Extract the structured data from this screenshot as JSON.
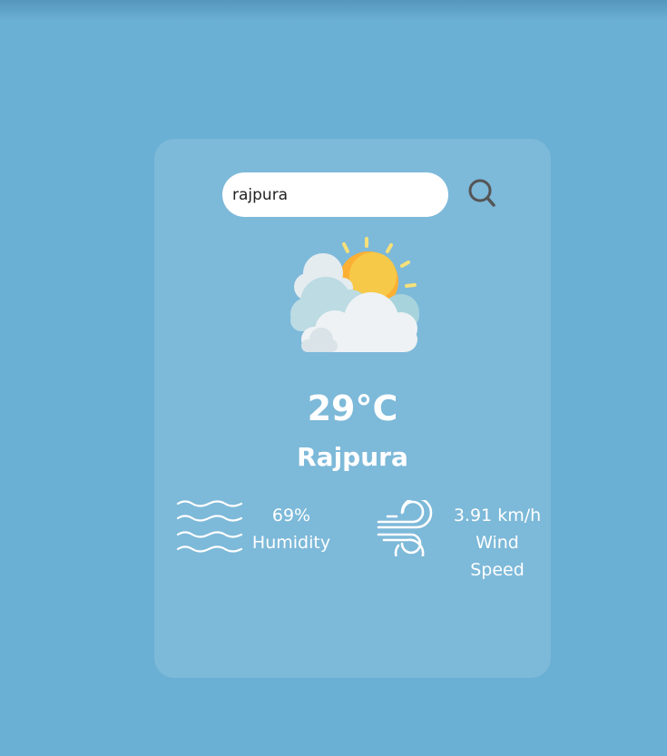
{
  "search": {
    "value": "rajpura",
    "button_icon": "search-icon"
  },
  "weather": {
    "icon": "partly-cloudy-sun-icon",
    "temperature": "29°C",
    "city": "Rajpura"
  },
  "humidity": {
    "icon": "humidity-waves-icon",
    "value": "69%",
    "label": "Humidity"
  },
  "wind": {
    "icon": "wind-icon",
    "value": "3.91 km/h",
    "label_line1": "Wind",
    "label_line2": "Speed"
  },
  "colors": {
    "background": "#6aafd4",
    "card": "rgba(255,255,255,0.13)",
    "text": "#ffffff",
    "sun": "#fbb034"
  }
}
